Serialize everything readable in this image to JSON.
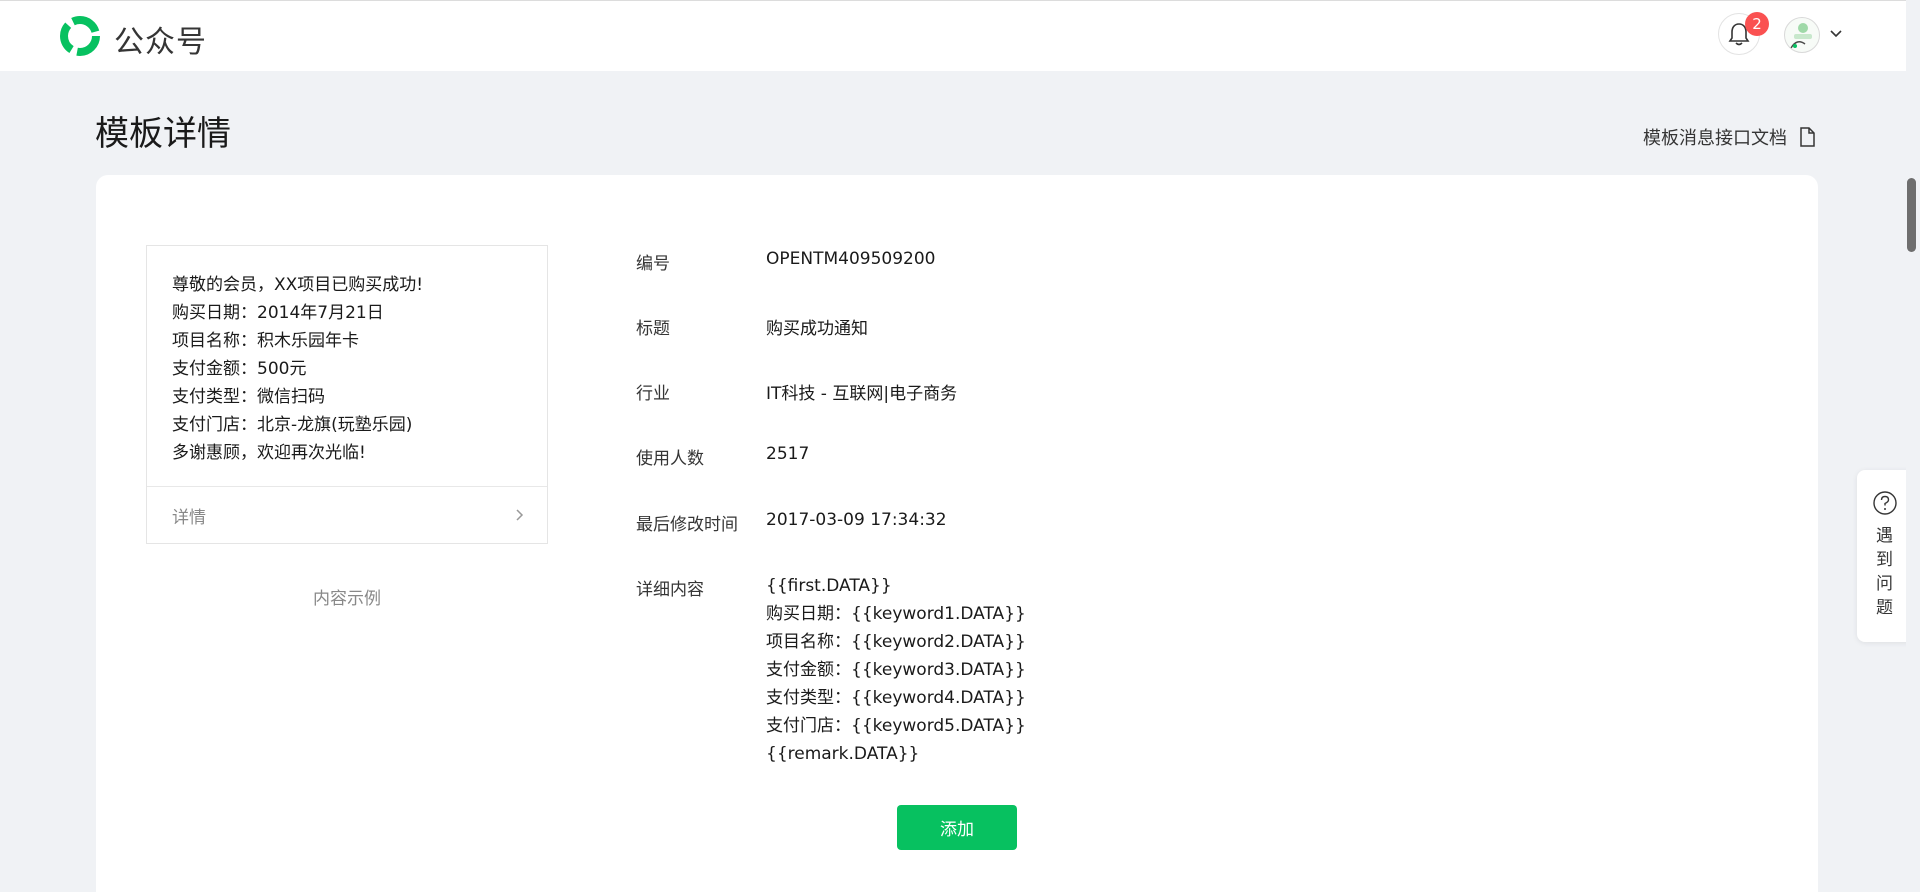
{
  "header": {
    "brand": "公众号",
    "notification_count": "2",
    "logo_icon": "wechat-official-account-logo",
    "brand_color": "#07c160"
  },
  "page": {
    "title": "模板详情",
    "doc_link": "模板消息接口文档"
  },
  "preview": {
    "lines": [
      "尊敬的会员，XX项目已购买成功!",
      "购买日期：2014年7月21日",
      "项目名称：积木乐园年卡",
      "支付金额：500元",
      "支付类型：微信扫码",
      "支付门店：北京-龙旗(玩塾乐园)",
      "多谢惠顾，欢迎再次光临!"
    ],
    "details_label": "详情",
    "caption": "内容示例"
  },
  "info": {
    "id_label": "编号",
    "id_value": "OPENTM409509200",
    "title_label": "标题",
    "title_value": "购买成功通知",
    "industry_label": "行业",
    "industry_value": "IT科技 - 互联网|电子商务",
    "users_label": "使用人数",
    "users_value": "2517",
    "modified_label": "最后修改时间",
    "modified_value": "2017-03-09 17:34:32",
    "detail_label": "详细内容",
    "detail_lines": [
      "{{first.DATA}}",
      "购买日期：{{keyword1.DATA}}",
      "项目名称：{{keyword2.DATA}}",
      "支付金额：{{keyword3.DATA}}",
      "支付类型：{{keyword4.DATA}}",
      "支付门店：{{keyword5.DATA}}",
      "{{remark.DATA}}"
    ]
  },
  "actions": {
    "add_label": "添加"
  },
  "help": {
    "label": "遇到问题"
  }
}
